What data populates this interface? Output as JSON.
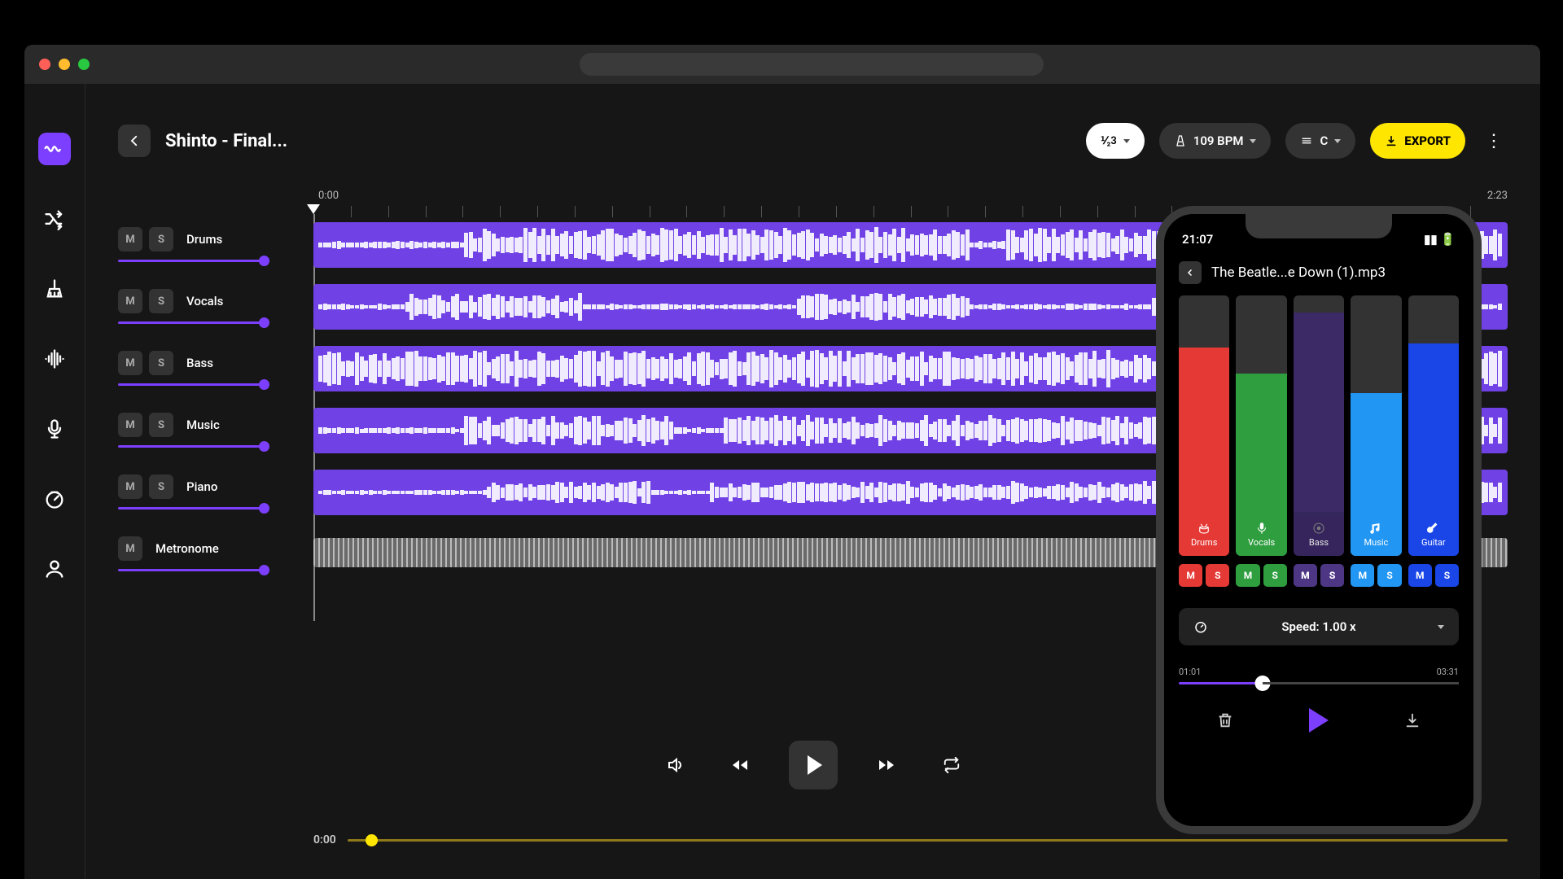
{
  "project_title": "Shinto - Final...",
  "header": {
    "count_in": "⅟₂3",
    "bpm": "109 BPM",
    "key": "C",
    "export": "EXPORT"
  },
  "time": {
    "start": "0:00",
    "end": "2:23"
  },
  "tracks": [
    {
      "mute": "M",
      "solo": "S",
      "name": "Drums"
    },
    {
      "mute": "M",
      "solo": "S",
      "name": "Vocals"
    },
    {
      "mute": "M",
      "solo": "S",
      "name": "Bass"
    },
    {
      "mute": "M",
      "solo": "S",
      "name": "Music"
    },
    {
      "mute": "M",
      "solo": "S",
      "name": "Piano"
    },
    {
      "mute": "M",
      "solo": "",
      "name": "Metronome"
    }
  ],
  "seek": {
    "current": "0:00"
  },
  "phone": {
    "status_time": "21:07",
    "title": "The Beatle...e Down (1).mp3",
    "stems": [
      {
        "name": "Drums",
        "color": "#e53935",
        "level": 0.76
      },
      {
        "name": "Vocals",
        "color": "#2e9e3f",
        "level": 0.64
      },
      {
        "name": "Bass",
        "color": "#3b2a66",
        "level": 0.92,
        "dim": true
      },
      {
        "name": "Music",
        "color": "#2196f3",
        "level": 0.55
      },
      {
        "name": "Guitar",
        "color": "#1a46e8",
        "level": 0.78
      }
    ],
    "ms_m": "M",
    "ms_s": "S",
    "speed_label": "Speed: 1.00 x",
    "seek_start": "01:01",
    "seek_end": "03:31"
  }
}
